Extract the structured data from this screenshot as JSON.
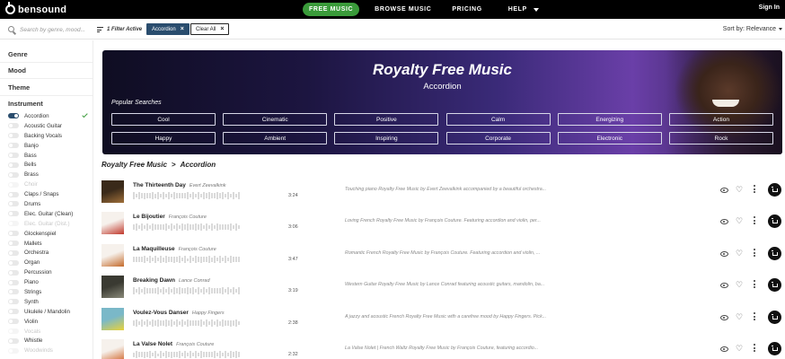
{
  "nav": {
    "logo": "bensound",
    "links": [
      "FREE MUSIC",
      "BROWSE MUSIC",
      "PRICING",
      "HELP"
    ],
    "signin": "Sign In"
  },
  "filterbar": {
    "search_placeholder": "Search by genre, mood...",
    "filters_active": "1 Filter Active",
    "chip_label": "Accordion",
    "clear_label": "Clear All",
    "sort_label": "Sort by:",
    "sort_value": "Relevance"
  },
  "sidebar": {
    "sections": [
      "Genre",
      "Mood",
      "Theme",
      "Instrument"
    ],
    "instruments": [
      {
        "label": "Accordion",
        "active": true
      },
      {
        "label": "Acoustic Guitar",
        "active": false
      },
      {
        "label": "Backing Vocals",
        "active": false
      },
      {
        "label": "Banjo",
        "active": false
      },
      {
        "label": "Bass",
        "active": false
      },
      {
        "label": "Bells",
        "active": false
      },
      {
        "label": "Brass",
        "active": false
      },
      {
        "label": "Choir",
        "disabled": true
      },
      {
        "label": "Claps / Snaps",
        "active": false
      },
      {
        "label": "Drums",
        "active": false
      },
      {
        "label": "Elec. Guitar (Clean)",
        "active": false
      },
      {
        "label": "Elec. Guitar (Dist.)",
        "disabled": true
      },
      {
        "label": "Glockenspiel",
        "active": false
      },
      {
        "label": "Mallets",
        "active": false
      },
      {
        "label": "Orchestra",
        "active": false
      },
      {
        "label": "Organ",
        "active": false
      },
      {
        "label": "Percussion",
        "active": false
      },
      {
        "label": "Piano",
        "active": false
      },
      {
        "label": "Strings",
        "active": false
      },
      {
        "label": "Synth",
        "active": false
      },
      {
        "label": "Ukulele / Mandolin",
        "active": false
      },
      {
        "label": "Violin",
        "active": false
      },
      {
        "label": "Vocals",
        "disabled": true
      },
      {
        "label": "Whistle",
        "active": false
      },
      {
        "label": "Woodwinds",
        "disabled": true
      }
    ]
  },
  "hero": {
    "title": "Royalty Free Music",
    "subtitle": "Accordion",
    "popular_label": "Popular Searches",
    "popular": [
      "Cool",
      "Cinematic",
      "Positive",
      "Calm",
      "Energizing",
      "Action",
      "Happy",
      "Ambient",
      "Inspiring",
      "Corporate",
      "Electronic",
      "Rock"
    ]
  },
  "breadcrumb": {
    "root": "Royalty Free Music",
    "separator": ">",
    "current": "Accordion"
  },
  "tracks": [
    {
      "title": "The Thirteenth Day",
      "artist": "Evert Zeevalkink",
      "duration": "3:24",
      "description": "Touching piano Royalty Free Music by Evert Zeevalkink accompanied by a beautiful orchestra...",
      "thumb_colors": [
        "#3a2a1a",
        "#a0703a"
      ]
    },
    {
      "title": "Le Bijoutier",
      "artist": "François Couture",
      "duration": "3:06",
      "description": "Loving French Royalty Free Music by François Couture. Featuring accordion and violin, per...",
      "thumb_colors": [
        "#f6f1ec",
        "#c0382b"
      ]
    },
    {
      "title": "La Maquilleuse",
      "artist": "François Couture",
      "duration": "3:47",
      "description": "Romantic French Royalty Free Music by François Couture. Featuring accordion and violin, ...",
      "thumb_colors": [
        "#f6f1ec",
        "#c46a2a"
      ]
    },
    {
      "title": "Breaking Dawn",
      "artist": "Lance Conrad",
      "duration": "3:19",
      "description": "Western Guitar Royalty Free Music by Lance Conrad featuring acoustic guitars, mandolin, ba...",
      "thumb_colors": [
        "#3a3a32",
        "#8a8a7a"
      ]
    },
    {
      "title": "Voulez-Vous Danser",
      "artist": "Happy Fingers",
      "duration": "2:38",
      "description": "A jazzy and acoustic French Royalty Free Music with a carefree mood by Happy Fingers. Pick...",
      "thumb_colors": [
        "#7ab8c8",
        "#e8d23a"
      ]
    },
    {
      "title": "La Valse Nolet",
      "artist": "François Couture",
      "duration": "2:32",
      "description": "La Valse Nolet | French Waltz Royalty Free Music by François Couture, featuring accordio...",
      "thumb_colors": [
        "#f6f1ec",
        "#d0662a"
      ]
    }
  ]
}
